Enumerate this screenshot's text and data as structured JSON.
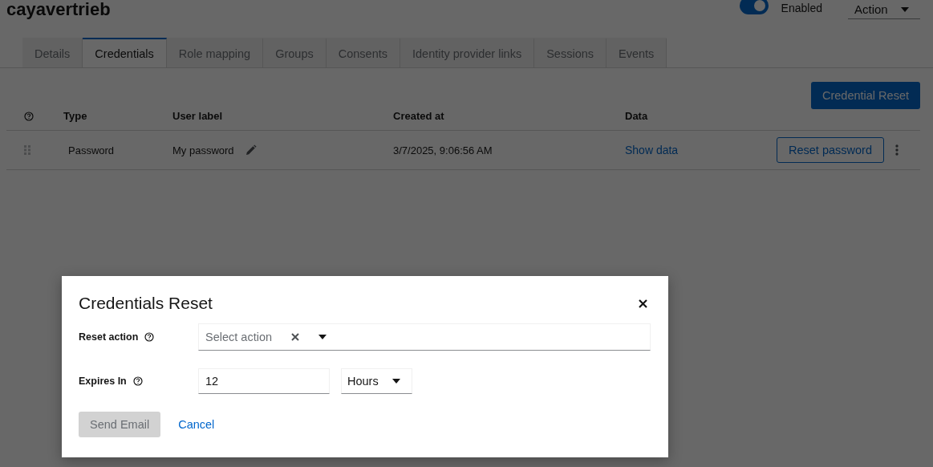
{
  "header": {
    "title": "cayavertrieb",
    "enabled_toggle": {
      "label": "Enabled",
      "on": true
    },
    "action_menu": {
      "label": "Action"
    }
  },
  "tabs": [
    {
      "label": "Details",
      "selected": false
    },
    {
      "label": "Credentials",
      "selected": true
    },
    {
      "label": "Role mapping",
      "selected": false
    },
    {
      "label": "Groups",
      "selected": false
    },
    {
      "label": "Consents",
      "selected": false
    },
    {
      "label": "Identity provider links",
      "selected": false
    },
    {
      "label": "Sessions",
      "selected": false
    },
    {
      "label": "Events",
      "selected": false
    }
  ],
  "toolbar": {
    "button": "Credential Reset"
  },
  "table": {
    "columns": [
      "Type",
      "User label",
      "Created at",
      "Data"
    ],
    "rows": [
      {
        "type": "Password",
        "user_label": "My password",
        "created_at": "3/7/2025, 9:06:56 AM",
        "data_link": "Show data",
        "action_button": "Reset password"
      }
    ]
  },
  "dialog": {
    "title": "Credentials Reset",
    "reset_action": {
      "label": "Reset action",
      "placeholder": "Select action"
    },
    "expires_in": {
      "label": "Expires In",
      "value": "12",
      "unit": "Hours"
    },
    "buttons": [
      {
        "kind": "primary",
        "label": "Send Email",
        "disabled": true
      },
      {
        "kind": "link",
        "label": "Cancel",
        "disabled": false
      }
    ]
  }
}
